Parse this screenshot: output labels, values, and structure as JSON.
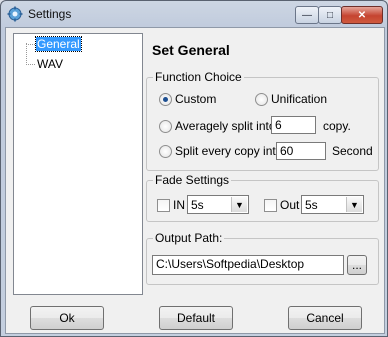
{
  "window": {
    "title": "Settings"
  },
  "tree": {
    "items": [
      {
        "label": "General"
      },
      {
        "label": "WAV"
      }
    ]
  },
  "heading": "Set General",
  "function_choice": {
    "title": "Function Choice",
    "custom_label": "Custom",
    "unification_label": "Unification",
    "averagely_label": "Averagely split into",
    "averagely_value": "6",
    "copy_label": "copy.",
    "split_every_label": "Split every copy into",
    "split_every_value": "60",
    "second_label": "Second",
    "selected": "Custom"
  },
  "fade_settings": {
    "title": "Fade Settings",
    "in_label": "IN",
    "in_value": "5s",
    "out_label": "Out",
    "out_value": "5s"
  },
  "output": {
    "title": "Output Path:",
    "path": "C:\\Users\\Softpedia\\Desktop",
    "browse_label": "..."
  },
  "buttons": {
    "ok": "Ok",
    "default": "Default",
    "cancel": "Cancel"
  },
  "caption_buttons": {
    "minimize": "—",
    "maximize": "□",
    "close": "✕"
  }
}
